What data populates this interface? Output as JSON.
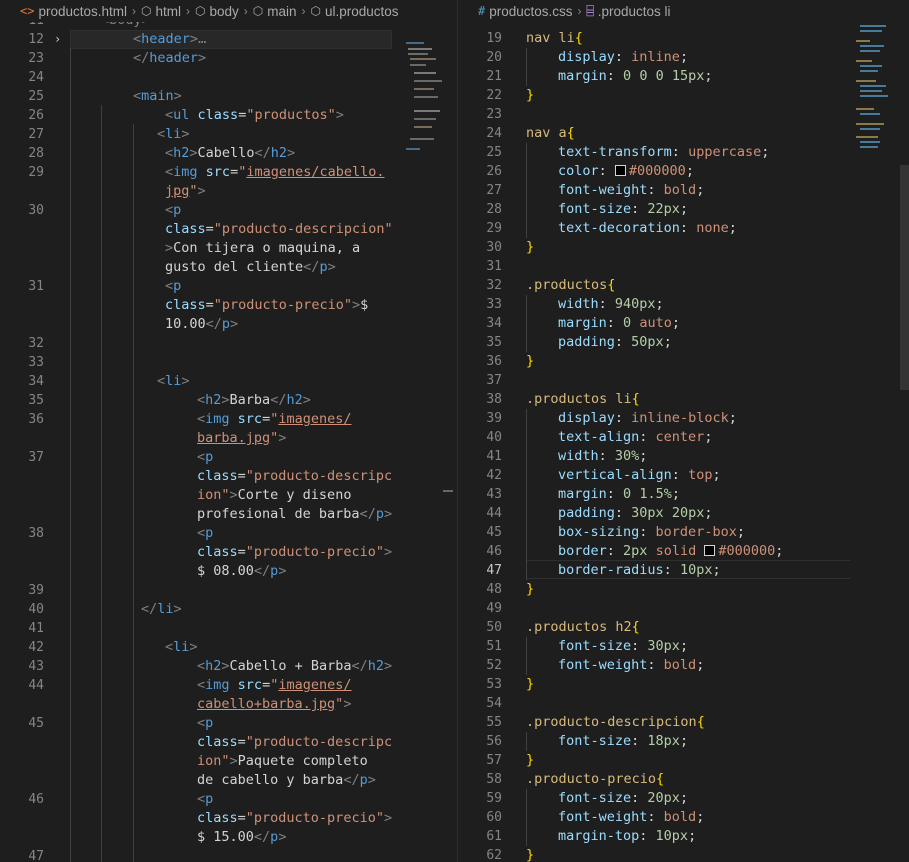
{
  "left_editor": {
    "breadcrumb": [
      "productos.html",
      "html",
      "body",
      "main",
      "ul.productos"
    ],
    "partial_top": "<body>",
    "lines": [
      {
        "n": "12",
        "t": "<header>…"
      },
      {
        "n": "23",
        "t": "</header>"
      },
      {
        "n": "24",
        "t": ""
      },
      {
        "n": "25",
        "t": "<main>"
      },
      {
        "n": "26",
        "t": "<ul class=\"productos\">"
      },
      {
        "n": "27",
        "t": "<li>"
      },
      {
        "n": "28",
        "t": "<h2>Cabello</h2>"
      },
      {
        "n": "29",
        "t": "<img src=\"imagenes/cabello.jpg\">"
      },
      {
        "n": "30",
        "t": "<p class=\"producto-descripcion\">Con tijera o maquina, a gusto del cliente</p>"
      },
      {
        "n": "31",
        "t": "<p class=\"producto-precio\">$ 10.00</p>"
      },
      {
        "n": "32",
        "t": ""
      },
      {
        "n": "33",
        "t": ""
      },
      {
        "n": "34",
        "t": "<li>"
      },
      {
        "n": "35",
        "t": "<h2>Barba</h2>"
      },
      {
        "n": "36",
        "t": "<img src=\"imagenes/barba.jpg\">"
      },
      {
        "n": "37",
        "t": "<p class=\"producto-descripcion\">Corte y diseno profesional de barba</p>"
      },
      {
        "n": "38",
        "t": "<p class=\"producto-precio\">$ 08.00</p>"
      },
      {
        "n": "39",
        "t": ""
      },
      {
        "n": "40",
        "t": "</li>"
      },
      {
        "n": "41",
        "t": ""
      },
      {
        "n": "42",
        "t": "<li>"
      },
      {
        "n": "43",
        "t": "<h2>Cabello + Barba</h2>"
      },
      {
        "n": "44",
        "t": "<img src=\"imagenes/cabello+barba.jpg\">"
      },
      {
        "n": "45",
        "t": "<p class=\"producto-descripcion\">Paquete completo de cabello y barba</p>"
      },
      {
        "n": "46",
        "t": "<p class=\"producto-precio\">$ 15.00</p>"
      },
      {
        "n": "47",
        "t": ""
      }
    ],
    "fold_ellipsis": "…",
    "tokens": {
      "header_open": "header",
      "header_close": "header",
      "main": "main",
      "ul": "ul",
      "li": "li",
      "h2": "h2",
      "img": "img",
      "p": "p",
      "class_attr": "class",
      "src_attr": "src",
      "cls_productos": "\"productos\"",
      "cls_desc": "\"producto-descripcion\"",
      "cls_desc_a": "\"producto-descripc",
      "cls_desc_b": "ion\"",
      "cls_precio": "\"producto-precio\"",
      "h2_cabello": "Cabello",
      "h2_barba": "Barba",
      "h2_combo": "Cabello + Barba",
      "src_cabello_a": "imagenes/cabello.",
      "src_cabello_b": "jpg",
      "src_barba_a": "imagenes/",
      "src_barba_b": "barba.jpg",
      "src_combo_a": "imagenes/",
      "src_combo_b": "cabello+barba.jpg",
      "desc1_a": "Con tijera o maquina, a",
      "desc1_b": "gusto del cliente",
      "desc2_a": "Corte y diseno",
      "desc2_b": "profesional de barba",
      "desc3_a": "Paquete completo",
      "desc3_b": "de cabello y barba",
      "price1_a": "$",
      "price1_b": "10.00",
      "price2": "$ 08.00",
      "price3": "$ 15.00"
    }
  },
  "right_editor": {
    "breadcrumb": [
      "productos.css",
      ".productos li"
    ],
    "active_line": "47",
    "lines": [
      {
        "n": "19",
        "t": "nav li{"
      },
      {
        "n": "20",
        "t": "display: inline;"
      },
      {
        "n": "21",
        "t": "margin: 0 0 0 15px;"
      },
      {
        "n": "22",
        "t": "}"
      },
      {
        "n": "23",
        "t": ""
      },
      {
        "n": "24",
        "t": "nav a{"
      },
      {
        "n": "25",
        "t": "text-transform: uppercase;"
      },
      {
        "n": "26",
        "t": "color: #000000;"
      },
      {
        "n": "27",
        "t": "font-weight: bold;"
      },
      {
        "n": "28",
        "t": "font-size: 22px;"
      },
      {
        "n": "29",
        "t": "text-decoration: none;"
      },
      {
        "n": "30",
        "t": "}"
      },
      {
        "n": "31",
        "t": ""
      },
      {
        "n": "32",
        "t": ".productos{"
      },
      {
        "n": "33",
        "t": "width: 940px;"
      },
      {
        "n": "34",
        "t": "margin: 0 auto;"
      },
      {
        "n": "35",
        "t": "padding: 50px;"
      },
      {
        "n": "36",
        "t": "}"
      },
      {
        "n": "37",
        "t": ""
      },
      {
        "n": "38",
        "t": ".productos li{"
      },
      {
        "n": "39",
        "t": "display: inline-block;"
      },
      {
        "n": "40",
        "t": "text-align: center;"
      },
      {
        "n": "41",
        "t": "width: 30%;"
      },
      {
        "n": "42",
        "t": "vertical-align: top;"
      },
      {
        "n": "43",
        "t": "margin: 0 1.5%;"
      },
      {
        "n": "44",
        "t": "padding: 30px 20px;"
      },
      {
        "n": "45",
        "t": "box-sizing: border-box;"
      },
      {
        "n": "46",
        "t": "border: 2px solid #000000;"
      },
      {
        "n": "47",
        "t": "border-radius: 10px;"
      },
      {
        "n": "48",
        "t": "}"
      },
      {
        "n": "49",
        "t": ""
      },
      {
        "n": "50",
        "t": ".productos h2{"
      },
      {
        "n": "51",
        "t": "font-size: 30px;"
      },
      {
        "n": "52",
        "t": "font-weight: bold;"
      },
      {
        "n": "53",
        "t": "}"
      },
      {
        "n": "54",
        "t": ""
      },
      {
        "n": "55",
        "t": ".producto-descripcion{"
      },
      {
        "n": "56",
        "t": "font-size: 18px;"
      },
      {
        "n": "57",
        "t": "}"
      },
      {
        "n": "58",
        "t": ".producto-precio{"
      },
      {
        "n": "59",
        "t": "font-size: 20px;"
      },
      {
        "n": "60",
        "t": "font-weight: bold;"
      },
      {
        "n": "61",
        "t": "margin-top: 10px;"
      },
      {
        "n": "62",
        "t": "}"
      }
    ],
    "swatch_color": "#000000"
  },
  "colors": {
    "editor_bg": "#1e1e1e",
    "tag": "#569cd6",
    "attribute": "#9cdcfe",
    "string": "#ce9178",
    "selector": "#d7ba7d",
    "number": "#b5cea8",
    "brace": "#ffd700",
    "line_number": "#858585"
  },
  "icons": {
    "html_file": "html-file-icon",
    "css_file": "css-hash-icon",
    "element": "element-cube-icon",
    "symbol": "css-symbol-icon",
    "fold": "chevron-right-icon"
  }
}
